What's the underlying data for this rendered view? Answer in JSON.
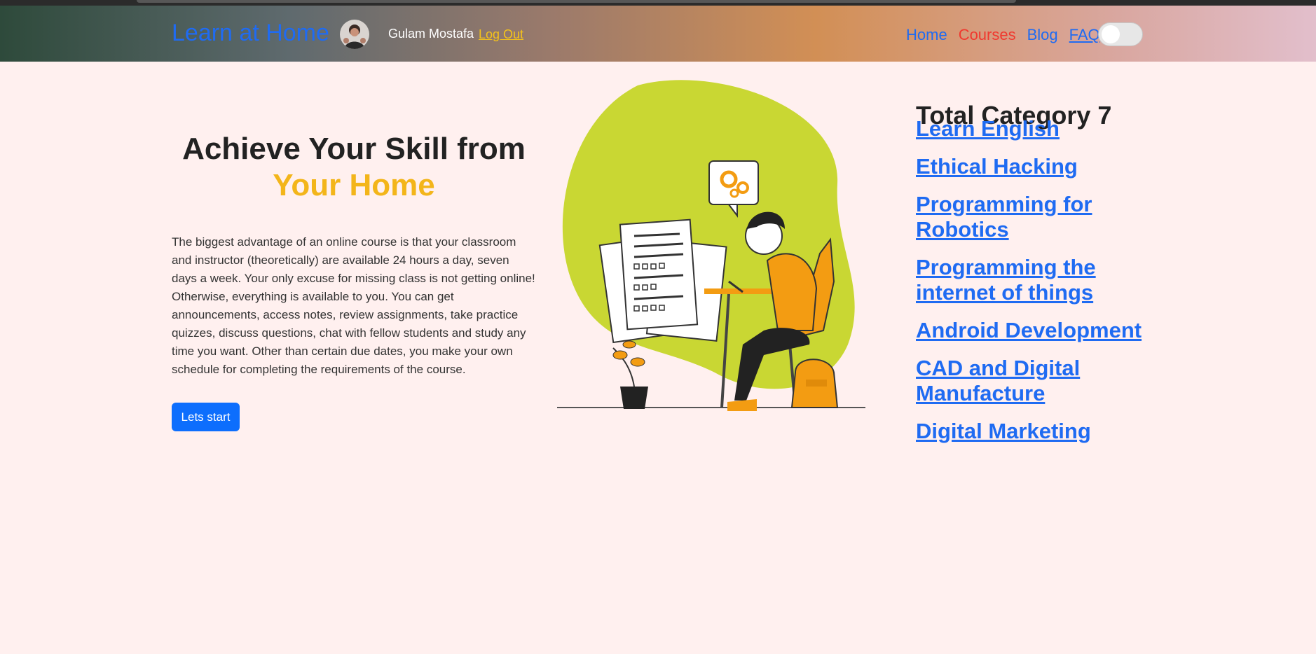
{
  "navbar": {
    "brand": "Learn at Home",
    "user_name": "Gulam Mostafa",
    "logout_label": "Log Out",
    "links": [
      "Home",
      "Courses",
      "Blog",
      "FAQ"
    ],
    "active_link": "Courses",
    "theme_toggle_on": false
  },
  "hero": {
    "title_line1": "Achieve Your Skill from",
    "title_line2": "Your Home",
    "description": "The biggest advantage of an online course is that your classroom and instructor (theoretically) are available 24 hours a day, seven days a week. Your only excuse for missing class is not getting online! Otherwise, everything is available to you. You can get announcements, access notes, review assignments, take practice quizzes, discuss questions, chat with fellow students and study any time you want. Other than certain due dates, you make your own schedule for completing the requirements of the course.",
    "cta_label": "Lets start"
  },
  "categories": {
    "title": "Total Category 7",
    "items": [
      "Learn English",
      "Ethical Hacking",
      "Programming for Robotics",
      "Programming the internet of things",
      "Android Development",
      "CAD and Digital Manufacture",
      "Digital Marketing"
    ]
  },
  "colors": {
    "brand": "#1f6bf2",
    "active": "#f0392f",
    "accent": "#f3b51a",
    "button": "#0d6efd",
    "page_bg": "#fff0ef"
  }
}
